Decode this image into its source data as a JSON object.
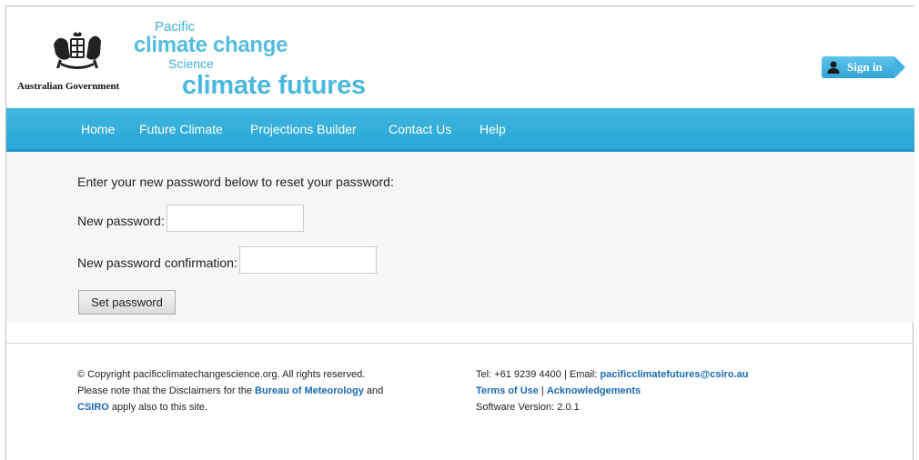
{
  "header": {
    "gov_text": "Australian Government",
    "brand": {
      "pacific": "Pacific",
      "climate_change": "climate change",
      "science": "Science",
      "climate_futures": "climate futures"
    },
    "signin_label": "Sign in"
  },
  "nav": {
    "items": [
      "Home",
      "Future Climate",
      "Projections Builder",
      "Contact Us",
      "Help"
    ]
  },
  "form": {
    "intro": "Enter your new password below to reset your password:",
    "new_password_label": "New password:",
    "new_password_value": "",
    "confirm_label": "New password confirmation:",
    "confirm_value": "",
    "submit_label": "Set password"
  },
  "footer": {
    "copyright": "© Copyright pacificclimatechangescience.org. All rights reserved.",
    "disclaimer_prefix": "Please note that the Disclaimers for the ",
    "bom_link": "Bureau of Meteorology",
    "and": " and",
    "csiro_link": "CSIRO",
    "disclaimer_suffix": " apply also to this site.",
    "contact_prefix": "Tel: +61 9239 4400 | Email: ",
    "email_link": "pacificclimatefutures@csiro.au",
    "terms_link": "Terms of Use",
    "separator": " | ",
    "ack_link": "Acknowledgements",
    "version": "Software Version: 2.0.1"
  },
  "colors": {
    "nav_bg": "#2aa5d5",
    "brand_blue": "#4db8de",
    "link_blue": "#1a6ab0"
  }
}
